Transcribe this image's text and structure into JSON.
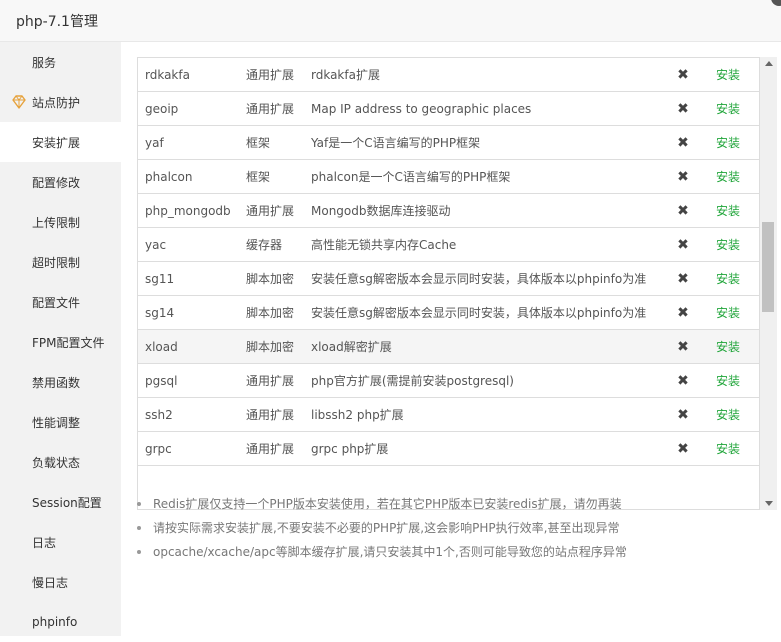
{
  "window": {
    "title": "php-7.1管理"
  },
  "sidebar": {
    "items": [
      {
        "label": "服务"
      },
      {
        "label": "站点防护"
      },
      {
        "label": "安装扩展"
      },
      {
        "label": "配置修改"
      },
      {
        "label": "上传限制"
      },
      {
        "label": "超时限制"
      },
      {
        "label": "配置文件"
      },
      {
        "label": "FPM配置文件"
      },
      {
        "label": "禁用函数"
      },
      {
        "label": "性能调整"
      },
      {
        "label": "负载状态"
      },
      {
        "label": "Session配置"
      },
      {
        "label": "日志"
      },
      {
        "label": "慢日志"
      },
      {
        "label": "phpinfo"
      }
    ],
    "active_index": 2
  },
  "extensions": {
    "remove_glyph": "✖",
    "rows": [
      {
        "name": "rdkakfa",
        "type": "通用扩展",
        "desc": "rdkakfa扩展",
        "action": "安装"
      },
      {
        "name": "geoip",
        "type": "通用扩展",
        "desc": "Map IP address to geographic places",
        "action": "安装"
      },
      {
        "name": "yaf",
        "type": "框架",
        "desc": "Yaf是一个C语言编写的PHP框架",
        "action": "安装"
      },
      {
        "name": "phalcon",
        "type": "框架",
        "desc": "phalcon是一个C语言编写的PHP框架",
        "action": "安装"
      },
      {
        "name": "php_mongodb",
        "type": "通用扩展",
        "desc": "Mongodb数据库连接驱动",
        "action": "安装"
      },
      {
        "name": "yac",
        "type": "缓存器",
        "desc": "高性能无锁共享内存Cache",
        "action": "安装"
      },
      {
        "name": "sg11",
        "type": "脚本加密",
        "desc": "安装任意sg解密版本会显示同时安装，具体版本以phpinfo为准",
        "action": "安装"
      },
      {
        "name": "sg14",
        "type": "脚本加密",
        "desc": "安装任意sg解密版本会显示同时安装，具体版本以phpinfo为准",
        "action": "安装"
      },
      {
        "name": "xload",
        "type": "脚本加密",
        "desc": "xload解密扩展",
        "action": "安装"
      },
      {
        "name": "pgsql",
        "type": "通用扩展",
        "desc": "php官方扩展(需提前安装postgresql)",
        "action": "安装"
      },
      {
        "name": "ssh2",
        "type": "通用扩展",
        "desc": "libssh2 php扩展",
        "action": "安装"
      },
      {
        "name": "grpc",
        "type": "通用扩展",
        "desc": "grpc php扩展",
        "action": "安装"
      }
    ]
  },
  "notes": [
    "Redis扩展仅支持一个PHP版本安装使用，若在其它PHP版本已安装redis扩展，请勿再装",
    "请按实际需求安装扩展,不要安装不必要的PHP扩展,这会影响PHP执行效率,甚至出现异常",
    "opcache/xcache/apc等脚本缓存扩展,请只安装其中1个,否则可能导致您的站点程序异常"
  ],
  "colors": {
    "install_green": "#20a53a",
    "sidebar_bg": "#f2f2f2",
    "shield_orange": "#e6a23c"
  }
}
